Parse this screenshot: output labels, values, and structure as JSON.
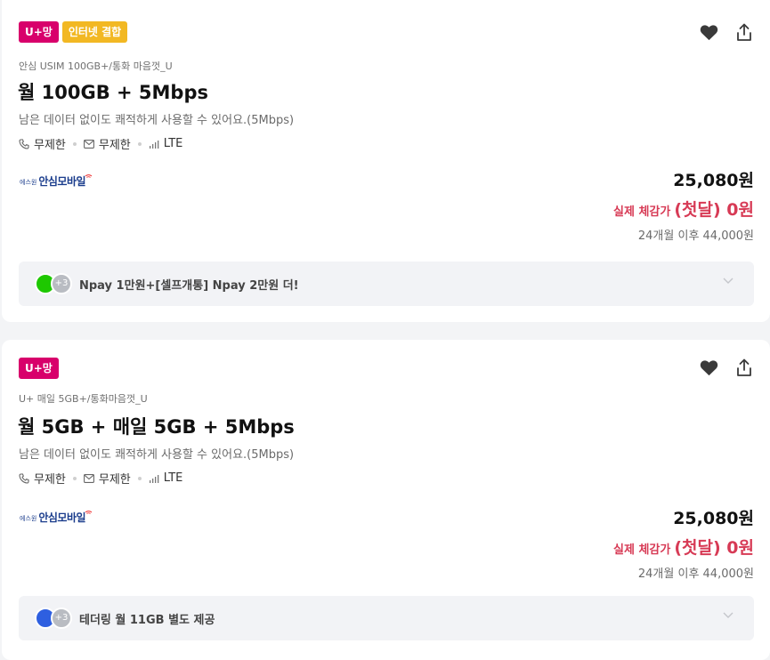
{
  "cards": [
    {
      "badges": [
        "U+망",
        "인터넷 결합"
      ],
      "subtitle": "안심 USIM 100GB+/통화 마음껏_U",
      "title": "월 100GB + 5Mbps",
      "desc": "남은 데이터 없이도 쾌적하게 사용할 수 있어요.(5Mbps)",
      "specs": {
        "call": "무제한",
        "sms": "무제한",
        "network": "LTE"
      },
      "provider": {
        "small": "에스원",
        "name": "안심모바일"
      },
      "price": "25,080원",
      "real_label": "실제 체감가",
      "real_value": "(첫달) 0원",
      "after": "24개월 이후 44,000원",
      "benefit": {
        "more": "+3",
        "text": "Npay 1만원+[셀프개통] Npay 2만원 더!"
      }
    },
    {
      "badges": [
        "U+망"
      ],
      "subtitle": "U+ 매일 5GB+/통화마음껏_U",
      "title": "월 5GB + 매일 5GB + 5Mbps",
      "desc": "남은 데이터 없이도 쾌적하게 사용할 수 있어요.(5Mbps)",
      "specs": {
        "call": "무제한",
        "sms": "무제한",
        "network": "LTE"
      },
      "provider": {
        "small": "에스원",
        "name": "안심모바일"
      },
      "price": "25,080원",
      "real_label": "실제 체감가",
      "real_value": "(첫달) 0원",
      "after": "24개월 이후 44,000원",
      "benefit": {
        "more": "+3",
        "text": "테더링 월 11GB 별도 제공"
      }
    }
  ],
  "icons": {
    "favorite": "heart-icon",
    "share": "share-icon",
    "call": "phone-icon",
    "sms": "mail-icon",
    "network": "signal-icon",
    "expand": "chevron-down-icon"
  },
  "colors": {
    "uplus_badge": "#d8006b",
    "internet_badge": "#f2b823",
    "real_price": "#d73a55",
    "provider": "#1a3c8c"
  }
}
